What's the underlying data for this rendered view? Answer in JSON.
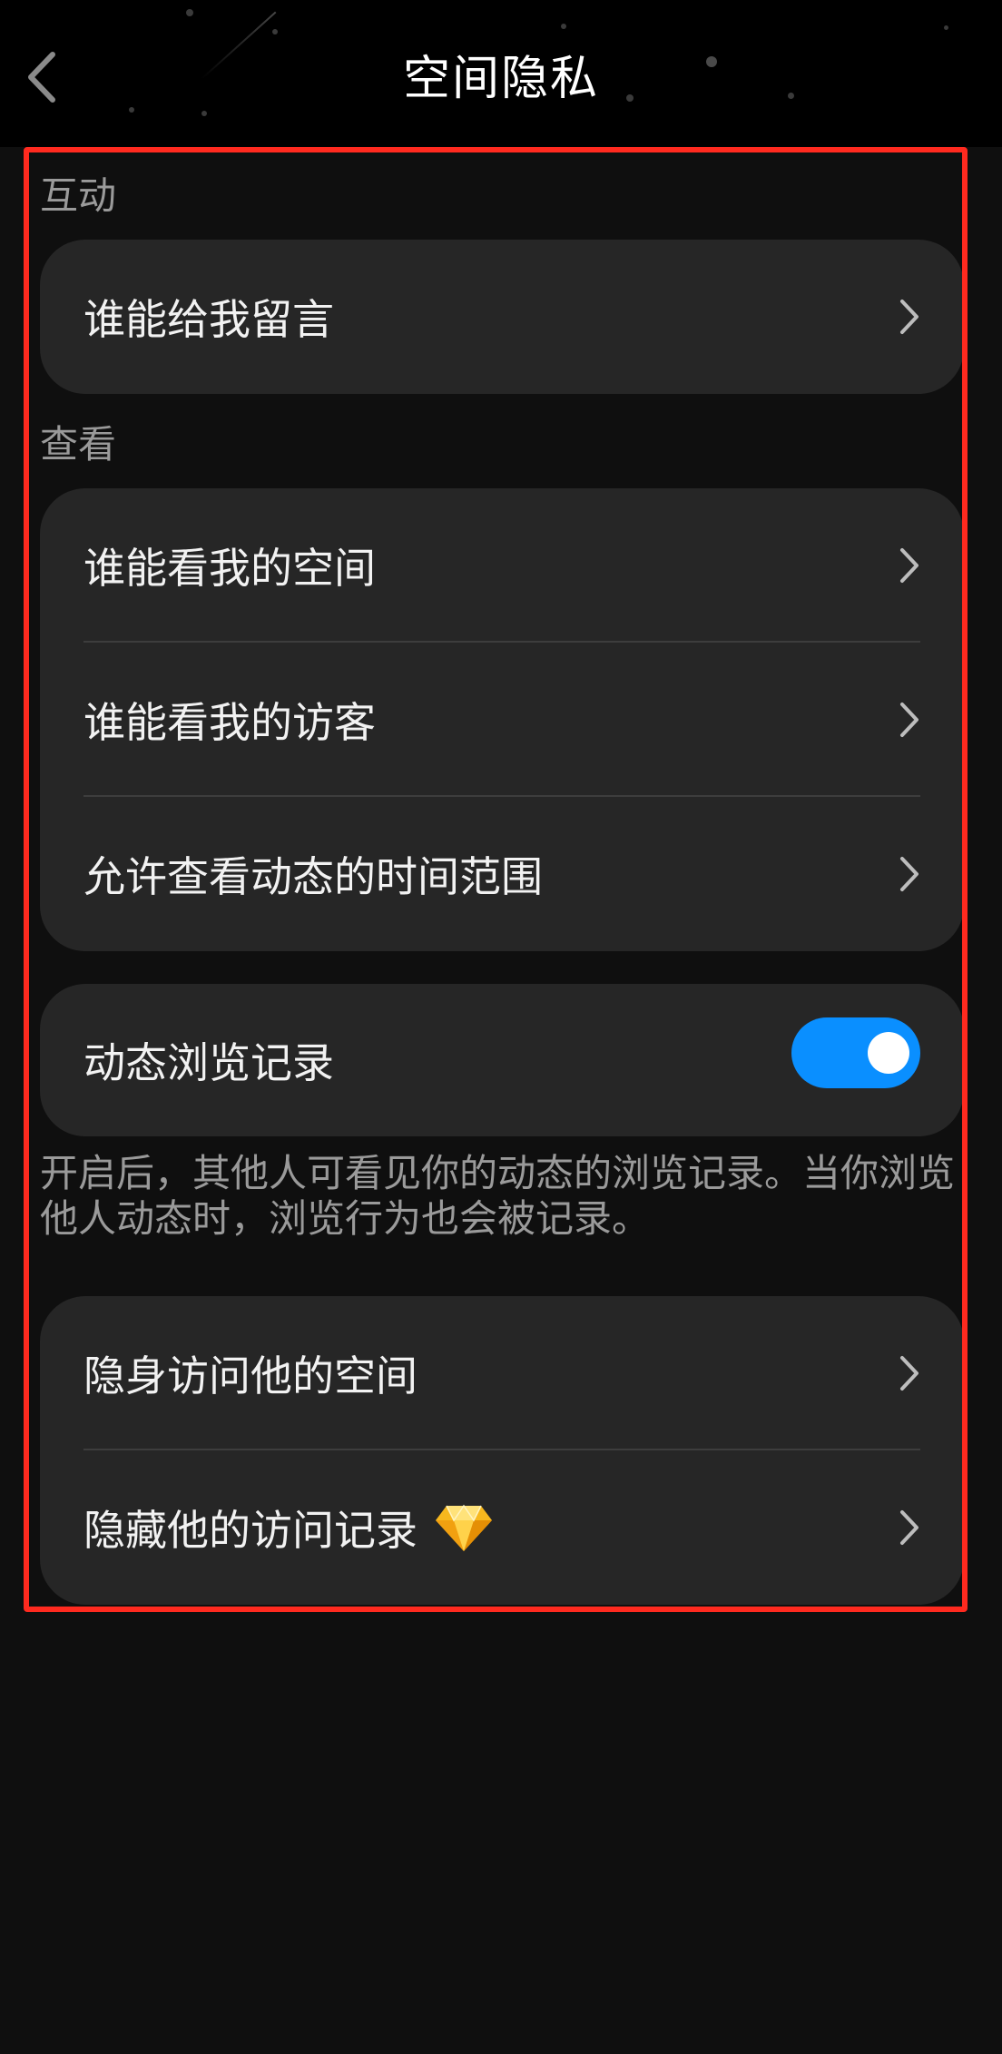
{
  "header": {
    "title": "空间隐私",
    "back_icon": "chevron-left-icon"
  },
  "sections": {
    "interaction_label": "互动",
    "view_label": "查看"
  },
  "rows": {
    "who_can_comment": "谁能给我留言",
    "who_can_see_space": "谁能看我的空间",
    "who_can_see_visitors": "谁能看我的访客",
    "feed_time_range": "允许查看动态的时间范围",
    "feed_browse_history": "动态浏览记录",
    "invisible_visit": "隐身访问他的空间",
    "hide_visit_record": "隐藏他的访问记录"
  },
  "toggle": {
    "feed_browse_history_on": true,
    "on_color": "#0a8fff"
  },
  "description": "开启后，其他人可看见你的动态的浏览记录。当你浏览他人动态时，浏览行为也会被记录。",
  "icons": {
    "row_chevron": "chevron-right-icon",
    "vip_badge": "diamond-icon"
  },
  "colors": {
    "background": "#0f0f0f",
    "card": "#262626",
    "highlight_border": "#ff2a1f"
  }
}
